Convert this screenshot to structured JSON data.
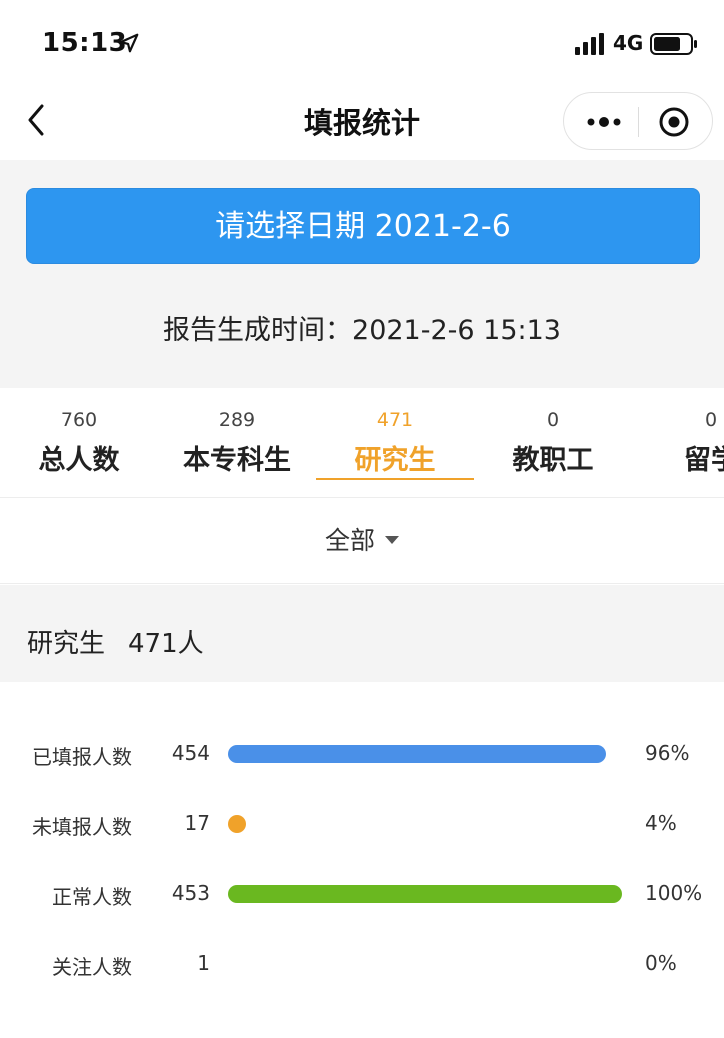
{
  "status_bar": {
    "time": "15:13",
    "network": "4G"
  },
  "nav": {
    "title": "填报统计",
    "back_icon": "chevron-left-icon",
    "more_icon": "more-dots-icon",
    "close_icon": "target-circle-icon"
  },
  "date_button": {
    "label": "请选择日期 2021-2-6"
  },
  "report": {
    "text": "报告生成时间：2021-2-6 15:13"
  },
  "tabs": [
    {
      "count": "760",
      "label": "总人数"
    },
    {
      "count": "289",
      "label": "本专科生"
    },
    {
      "count": "471",
      "label": "研究生",
      "active": true
    },
    {
      "count": "0",
      "label": "教职工"
    },
    {
      "count": "0",
      "label": "留学"
    }
  ],
  "filter": {
    "label": "全部"
  },
  "summary": {
    "label": "研究生",
    "count": "471人"
  },
  "stats": [
    {
      "label": "已填报人数",
      "count": "454",
      "percent": "96%",
      "fill": 0.96,
      "color": "#4a90e8"
    },
    {
      "label": "未填报人数",
      "count": "17",
      "percent": "4%",
      "fill": 0.04,
      "color": "#f0a22a"
    },
    {
      "label": "正常人数",
      "count": "453",
      "percent": "100%",
      "fill": 1.0,
      "color": "#6ab820"
    },
    {
      "label": "关注人数",
      "count": "1",
      "percent": "0%",
      "fill": 0.0,
      "color": "#e55c5c"
    }
  ],
  "colors": {
    "primary_blue": "#2d96f0",
    "active_orange": "#f0a22a"
  }
}
